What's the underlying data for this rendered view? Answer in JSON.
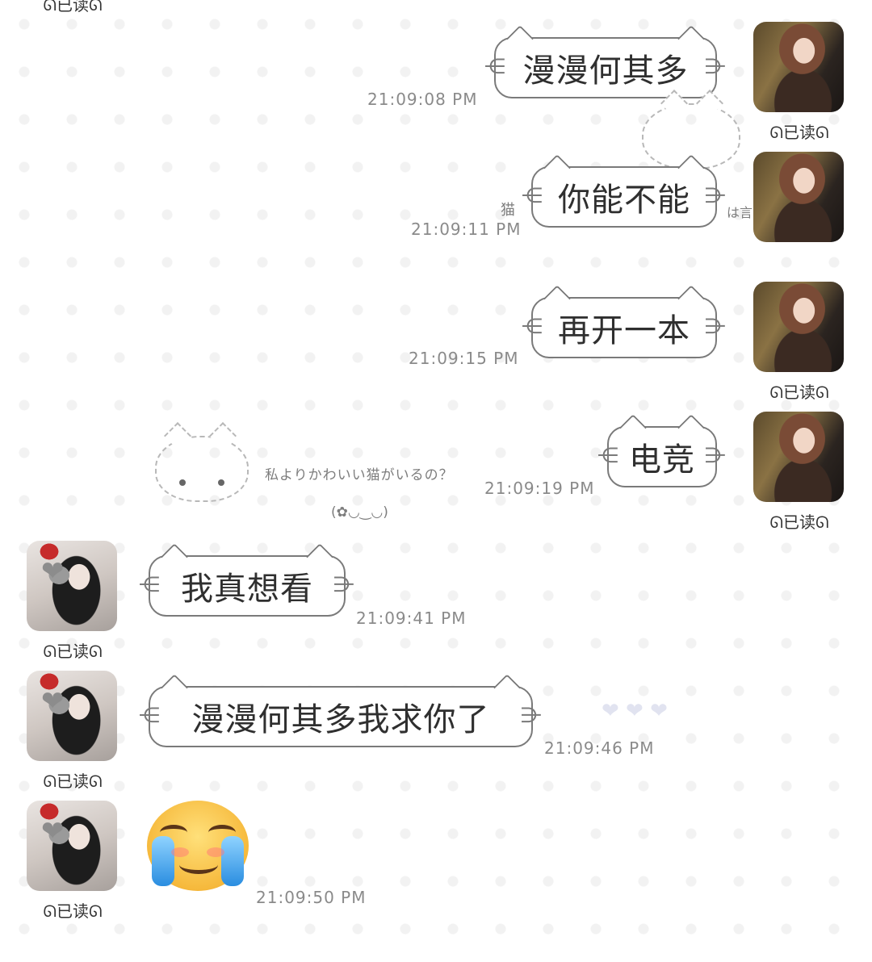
{
  "top_partial_read": "ᘏ已读ᘏ",
  "messages": [
    {
      "side": "right",
      "text": "漫漫何其多",
      "time": "21:09:08 PM",
      "read": "ᘏ已读ᘏ"
    },
    {
      "side": "right",
      "text": "你能不能",
      "time": "21:09:11 PM",
      "read": ""
    },
    {
      "side": "right",
      "text": "再开一本",
      "time": "21:09:15 PM",
      "read": "ᘏ已读ᘏ"
    },
    {
      "side": "right",
      "text": "电竞",
      "time": "21:09:19 PM",
      "read": "ᘏ已读ᘏ"
    },
    {
      "side": "left",
      "text": "我真想看",
      "time": "21:09:41 PM",
      "read": "ᘏ已读ᘏ"
    },
    {
      "side": "left",
      "text": "漫漫何其多我求你了",
      "time": "21:09:46 PM",
      "read": "ᘏ已读ᘏ"
    },
    {
      "side": "left",
      "text": "",
      "time": "21:09:50 PM",
      "read": "ᘏ已读ᘏ",
      "emoji": "crying-face-emoji"
    }
  ],
  "decor": {
    "cat_label_left": "猫",
    "cat_label_right": "は言",
    "jp_caption": "私よりかわいい猫がいるの？",
    "kaomoji": "(✿◡‿◡)",
    "hearts": "❤ ❤ ❤"
  },
  "icons": {
    "heart_badge": "heart-icon",
    "emoji": "crying-face-emoji"
  },
  "colors": {
    "bubble_border": "#7a7a7a",
    "time_text": "#8a8a8a",
    "pattern_heart": "#f2f2f2"
  }
}
